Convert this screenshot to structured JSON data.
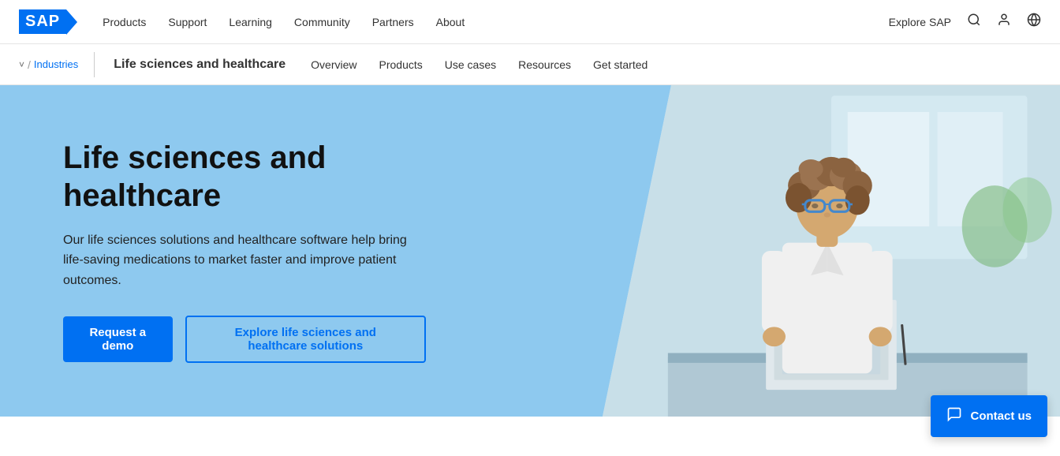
{
  "nav": {
    "logo_text": "SAP",
    "links": [
      {
        "label": "Products",
        "id": "nav-products"
      },
      {
        "label": "Support",
        "id": "nav-support"
      },
      {
        "label": "Learning",
        "id": "nav-learning"
      },
      {
        "label": "Community",
        "id": "nav-community"
      },
      {
        "label": "Partners",
        "id": "nav-partners"
      },
      {
        "label": "About",
        "id": "nav-about"
      }
    ],
    "explore_sap": "Explore SAP",
    "search_icon": "🔍",
    "user_icon": "👤",
    "globe_icon": "🌐"
  },
  "sub_nav": {
    "breadcrumb_chevron": "˅",
    "breadcrumb_sep": "/",
    "breadcrumb_industries": "Industries",
    "page_title": "Life sciences and healthcare",
    "links": [
      {
        "label": "Overview",
        "id": "sub-overview"
      },
      {
        "label": "Products",
        "id": "sub-products"
      },
      {
        "label": "Use cases",
        "id": "sub-usecases"
      },
      {
        "label": "Resources",
        "id": "sub-resources"
      },
      {
        "label": "Get started",
        "id": "sub-getstarted"
      }
    ]
  },
  "hero": {
    "title": "Life sciences and healthcare",
    "description": "Our life sciences solutions and healthcare software help bring life-saving medications to market faster and improve patient outcomes.",
    "btn_demo": "Request a demo",
    "btn_explore": "Explore life sciences and healthcare solutions"
  },
  "contact": {
    "label": "Contact us",
    "chat_icon": "💬"
  }
}
